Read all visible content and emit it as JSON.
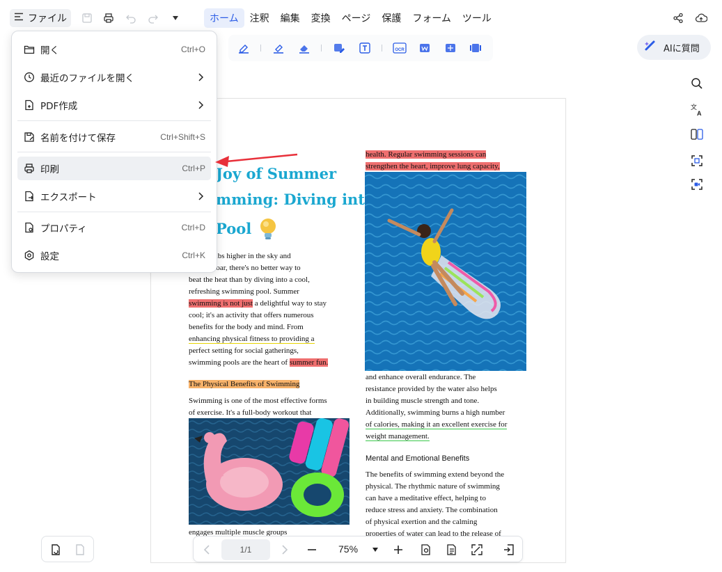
{
  "menubar": {
    "file_label": "ファイル",
    "tabs": [
      {
        "label": "ホーム",
        "active": true
      },
      {
        "label": "注釈",
        "active": false
      },
      {
        "label": "編集",
        "active": false
      },
      {
        "label": "変換",
        "active": false
      },
      {
        "label": "ページ",
        "active": false
      },
      {
        "label": "保護",
        "active": false
      },
      {
        "label": "フォーム",
        "active": false
      },
      {
        "label": "ツール",
        "active": false
      }
    ]
  },
  "toolbar": {
    "ai_label": "AIに質問",
    "ocr_label": "OCR"
  },
  "file_menu": {
    "items": [
      {
        "label": "開く",
        "shortcut": "Ctrl+O",
        "icon": "folder-open-icon"
      },
      {
        "label": "最近のファイルを開く",
        "shortcut": "",
        "icon": "clock-icon",
        "submenu": true
      },
      {
        "label": "PDF作成",
        "shortcut": "",
        "icon": "file-plus-icon",
        "submenu": true
      },
      {
        "label": "名前を付けて保存",
        "shortcut": "Ctrl+Shift+S",
        "icon": "save-as-icon"
      },
      {
        "label": "印刷",
        "shortcut": "Ctrl+P",
        "icon": "printer-icon",
        "hover": true
      },
      {
        "label": "エクスポート",
        "shortcut": "",
        "icon": "export-icon",
        "submenu": true
      },
      {
        "label": "プロパティ",
        "shortcut": "Ctrl+D",
        "icon": "properties-icon"
      },
      {
        "label": "設定",
        "shortcut": "Ctrl+K",
        "icon": "settings-icon"
      }
    ]
  },
  "document": {
    "title_lines": [
      "Joy of Summer",
      "mming: Diving into",
      "Pool"
    ],
    "left_col": {
      "intro": [
        "n climbs higher in the sky and",
        "ures soar, there's no better way to",
        "beat the heat than by diving into a cool,",
        "refreshing swimming pool. Summer"
      ],
      "hl_start": "swimming is not just",
      "hl_rest": " a delightful way to stay",
      "lines2": [
        "cool; it's an activity that offers numerous",
        "benefits for the body and mind. From"
      ],
      "ul_yellow": "enhancing physical fitness to providing a",
      "lines3": [
        "perfect setting for social gatherings,"
      ],
      "last_pre": "swimming pools are the heart of ",
      "last_hl": "summer fun.",
      "section_heading": "The Physical Benefits of Swimming",
      "section_lines": [
        "Swimming is one of the most effective forms",
        "of exercise. It's a full-body workout that"
      ],
      "after_photo": "engages multiple muscle groups"
    },
    "right_col": {
      "top_hl": [
        "health. Regular swimming sessions can",
        "strengthen the heart, improve lung capacity,"
      ],
      "lines": [
        "and enhance overall endurance. The",
        "resistance provided by the water also helps",
        "in building muscle strength and tone.",
        "Additionally, swimming burns a high number"
      ],
      "ul_green": [
        "of calories, making it an excellent exercise for",
        "weight management."
      ],
      "heading2": "Mental and Emotional Benefits",
      "lines2": [
        "The benefits of swimming extend beyond the",
        "physical. The rhythmic nature of swimming",
        "can have a meditative effect, helping to",
        "reduce stress and anxiety. The combination",
        "of physical exertion and the calming",
        "properties of water can lead to the release of"
      ]
    }
  },
  "bottom_bar": {
    "page_indicator": "1/1",
    "zoom": "75%"
  },
  "colors": {
    "accent": "#2b5ce6",
    "title": "#1aa7d0",
    "highlight_red": "#ef6f6f",
    "highlight_orange": "#f7b26a",
    "annotation_arrow": "#e8303a"
  }
}
